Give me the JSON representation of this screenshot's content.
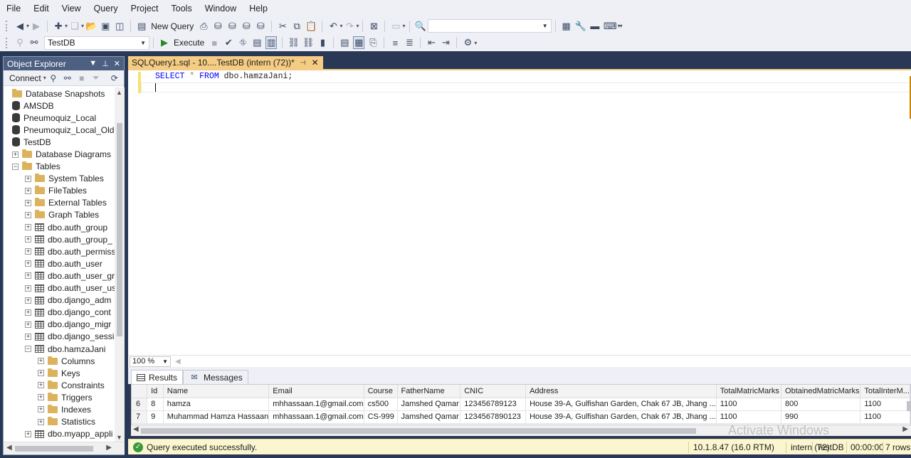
{
  "menu": [
    "File",
    "Edit",
    "View",
    "Query",
    "Project",
    "Tools",
    "Window",
    "Help"
  ],
  "toolbar": {
    "new_query_label": "New Query",
    "database_combo": "TestDB",
    "execute_label": "Execute",
    "search_combo_value": ""
  },
  "object_explorer": {
    "title": "Object Explorer",
    "connect_label": "Connect",
    "tree": [
      {
        "label": "Database Snapshots",
        "icon": "folder-icon",
        "indent": 0,
        "expander": "none"
      },
      {
        "label": "AMSDB",
        "icon": "database-icon",
        "indent": 0,
        "expander": "none"
      },
      {
        "label": "Pneumoquiz_Local",
        "icon": "database-icon",
        "indent": 0,
        "expander": "none"
      },
      {
        "label": "Pneumoquiz_Local_Old",
        "icon": "database-icon",
        "indent": 0,
        "expander": "none"
      },
      {
        "label": "TestDB",
        "icon": "database-icon",
        "indent": 0,
        "expander": "none"
      },
      {
        "label": "Database Diagrams",
        "icon": "folder-icon",
        "indent": 1,
        "expander": "plus"
      },
      {
        "label": "Tables",
        "icon": "folder-icon",
        "indent": 1,
        "expander": "minus"
      },
      {
        "label": "System Tables",
        "icon": "folder-icon",
        "indent": 2,
        "expander": "plus"
      },
      {
        "label": "FileTables",
        "icon": "folder-icon",
        "indent": 2,
        "expander": "plus"
      },
      {
        "label": "External Tables",
        "icon": "folder-icon",
        "indent": 2,
        "expander": "plus"
      },
      {
        "label": "Graph Tables",
        "icon": "folder-icon",
        "indent": 2,
        "expander": "plus"
      },
      {
        "label": "dbo.auth_group",
        "icon": "table-icon",
        "indent": 2,
        "expander": "plus"
      },
      {
        "label": "dbo.auth_group_",
        "icon": "table-icon",
        "indent": 2,
        "expander": "plus"
      },
      {
        "label": "dbo.auth_permiss",
        "icon": "table-icon",
        "indent": 2,
        "expander": "plus"
      },
      {
        "label": "dbo.auth_user",
        "icon": "table-icon",
        "indent": 2,
        "expander": "plus"
      },
      {
        "label": "dbo.auth_user_gr",
        "icon": "table-icon",
        "indent": 2,
        "expander": "plus"
      },
      {
        "label": "dbo.auth_user_us",
        "icon": "table-icon",
        "indent": 2,
        "expander": "plus"
      },
      {
        "label": "dbo.django_adm",
        "icon": "table-icon",
        "indent": 2,
        "expander": "plus"
      },
      {
        "label": "dbo.django_cont",
        "icon": "table-icon",
        "indent": 2,
        "expander": "plus"
      },
      {
        "label": "dbo.django_migr",
        "icon": "table-icon",
        "indent": 2,
        "expander": "plus"
      },
      {
        "label": "dbo.django_sessi",
        "icon": "table-icon",
        "indent": 2,
        "expander": "plus"
      },
      {
        "label": "dbo.hamzaJani",
        "icon": "table-icon",
        "indent": 2,
        "expander": "minus"
      },
      {
        "label": "Columns",
        "icon": "folder-icon",
        "indent": 3,
        "expander": "plus"
      },
      {
        "label": "Keys",
        "icon": "folder-icon",
        "indent": 3,
        "expander": "plus"
      },
      {
        "label": "Constraints",
        "icon": "folder-icon",
        "indent": 3,
        "expander": "plus"
      },
      {
        "label": "Triggers",
        "icon": "folder-icon",
        "indent": 3,
        "expander": "plus"
      },
      {
        "label": "Indexes",
        "icon": "folder-icon",
        "indent": 3,
        "expander": "plus"
      },
      {
        "label": "Statistics",
        "icon": "folder-icon",
        "indent": 3,
        "expander": "plus"
      },
      {
        "label": "dbo.myapp_appli",
        "icon": "table-icon",
        "indent": 2,
        "expander": "plus"
      }
    ]
  },
  "editor": {
    "tab_title": "SQLQuery1.sql - 10....TestDB (intern (72))*",
    "code": {
      "kw1": "SELECT",
      "star": "*",
      "kw2": "FROM",
      "table": "dbo.hamzaJani;"
    },
    "zoom": "100 %"
  },
  "results": {
    "tabs": [
      "Results",
      "Messages"
    ],
    "columns": [
      "",
      "Id",
      "Name",
      "Email",
      "Course",
      "FatherName",
      "CNIC",
      "Address",
      "TotalMatricMarks",
      "ObtainedMatricMarks",
      "TotalInterM..."
    ],
    "rows": [
      [
        "6",
        "8",
        "hamza",
        "mhhassaan.1@gmail.com",
        "cs500",
        "Jamshed Qamar",
        "123456789123",
        "House 39-A, Gulfishan Garden, Chak 67 JB, Jhang ...",
        "1100",
        "800",
        "1100"
      ],
      [
        "7",
        "9",
        "Muhammad Hamza Hassaan",
        "mhhassaan.1@gmail.com",
        "CS-999",
        "Jamshed Qamar",
        "1234567890123",
        "House 39-A, Gulfishan Garden, Chak 67 JB, Jhang ...",
        "1100",
        "990",
        "1100"
      ]
    ]
  },
  "watermark": "Activate Windows",
  "status": {
    "message": "Query executed successfully.",
    "server": "10.1.8.47 (16.0 RTM)",
    "user": "intern (72)",
    "database": "TestDB",
    "time": "00:00:00",
    "rows": "7 rows"
  },
  "colors": {
    "accent": "#f5cc84",
    "titlebar": "#4d6082",
    "frame": "#293955",
    "status_bg": "#fbf6d0",
    "keyword": "#0000ff"
  }
}
